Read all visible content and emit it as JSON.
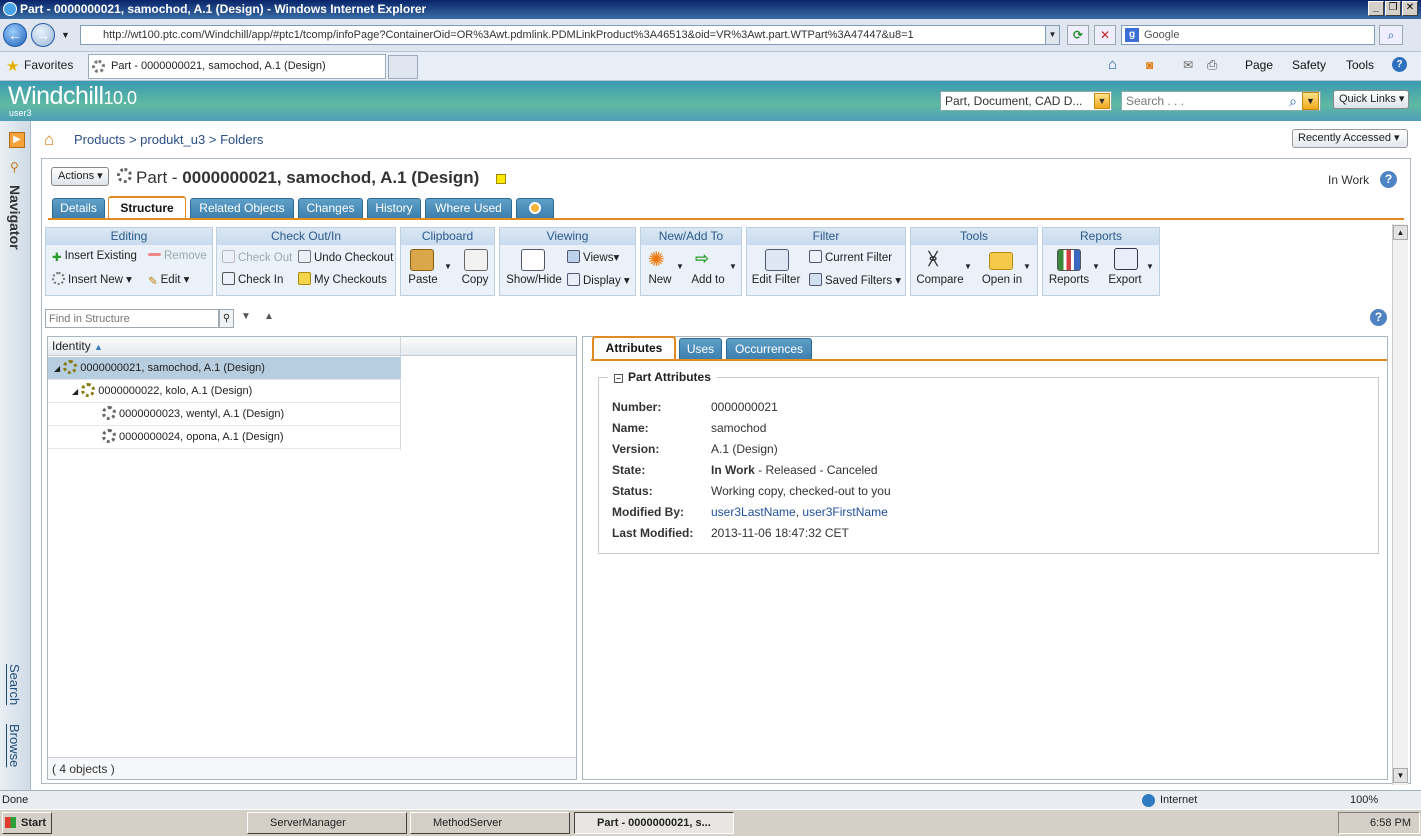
{
  "window": {
    "title": "Part - 0000000021, samochod, A.1 (Design) - Windows Internet Explorer"
  },
  "browser": {
    "url": "http://wt100.ptc.com/Windchill/app/#ptc1/tcomp/infoPage?ContainerOid=OR%3Awt.pdmlink.PDMLinkProduct%3A46513&oid=VR%3Awt.part.WTPart%3A47447&u8=1",
    "search_placeholder": "Google",
    "favorites_label": "Favorites",
    "tab_title": "Part - 0000000021, samochod, A.1 (Design)",
    "cmd": {
      "page": "Page",
      "safety": "Safety",
      "tools": "Tools"
    }
  },
  "app": {
    "logo": "Windchill",
    "version": "10.0",
    "user": "user3",
    "search_type": "Part, Document, CAD D...",
    "search_placeholder": "Search . . .",
    "quick_links": "Quick Links"
  },
  "sidebar": {
    "navigator": "Navigator",
    "search": "Search",
    "browse": "Browse"
  },
  "breadcrumb": [
    "Products",
    "produkt_u3",
    "Folders"
  ],
  "recently_accessed": "Recently Accessed",
  "page": {
    "actions_label": "Actions",
    "title_prefix": "Part - ",
    "title_main": "0000000021, samochod, A.1 (Design)",
    "state": "In Work"
  },
  "tabs": [
    "Details",
    "Structure",
    "Related Objects",
    "Changes",
    "History",
    "Where Used"
  ],
  "toolbar": {
    "editing": {
      "header": "Editing",
      "insert_existing": "Insert Existing",
      "remove": "Remove",
      "insert_new": "Insert New",
      "edit": "Edit"
    },
    "checkout": {
      "header": "Check Out/In",
      "check_out": "Check Out",
      "undo_checkout": "Undo Checkout",
      "check_in": "Check In",
      "my_checkouts": "My Checkouts"
    },
    "clipboard": {
      "header": "Clipboard",
      "paste": "Paste",
      "copy": "Copy"
    },
    "viewing": {
      "header": "Viewing",
      "show_hide": "Show/Hide",
      "views": "Views",
      "display": "Display"
    },
    "newadd": {
      "header": "New/Add To",
      "new": "New",
      "add_to": "Add to"
    },
    "filter": {
      "header": "Filter",
      "edit_filter": "Edit Filter",
      "current_filter": "Current Filter",
      "saved_filters": "Saved Filters"
    },
    "tools": {
      "header": "Tools",
      "compare": "Compare",
      "open_in": "Open in"
    },
    "reports": {
      "header": "Reports",
      "reports": "Reports",
      "export": "Export"
    }
  },
  "find_placeholder": "Find in Structure",
  "tree": {
    "column": "Identity",
    "rows": [
      "0000000021, samochod, A.1 (Design)",
      "0000000022, kolo, A.1 (Design)",
      "0000000023, wentyl, A.1 (Design)",
      "0000000024, opona, A.1 (Design)"
    ],
    "count": "( 4 objects )"
  },
  "details": {
    "tabs": [
      "Attributes",
      "Uses",
      "Occurrences"
    ],
    "section": "Part Attributes",
    "fields": {
      "number_label": "Number:",
      "number": "0000000021",
      "name_label": "Name:",
      "name": "samochod",
      "version_label": "Version:",
      "version": "A.1 (Design)",
      "state_label": "State:",
      "state_current": "In Work",
      "state_rest": " - Released - Canceled",
      "status_label": "Status:",
      "status": "Working copy, checked-out to you",
      "modified_by_label": "Modified By:",
      "modified_last": "user3LastName",
      "modified_sep": ", ",
      "modified_first": "user3FirstName",
      "last_modified_label": "Last Modified:",
      "last_modified": "2013-11-06 18:47:32 CET"
    }
  },
  "statusbar": {
    "left": "Done",
    "zone": "Internet",
    "zoom": "100%"
  },
  "taskbar": {
    "start": "Start",
    "items": [
      "ServerManager",
      "MethodServer",
      "Part - 0000000021, s..."
    ],
    "clock": "6:58 PM"
  },
  "colors": {
    "accent": "#e08b20",
    "tab_blue": "#3d7fae",
    "header_teal": "#4e9db6"
  }
}
